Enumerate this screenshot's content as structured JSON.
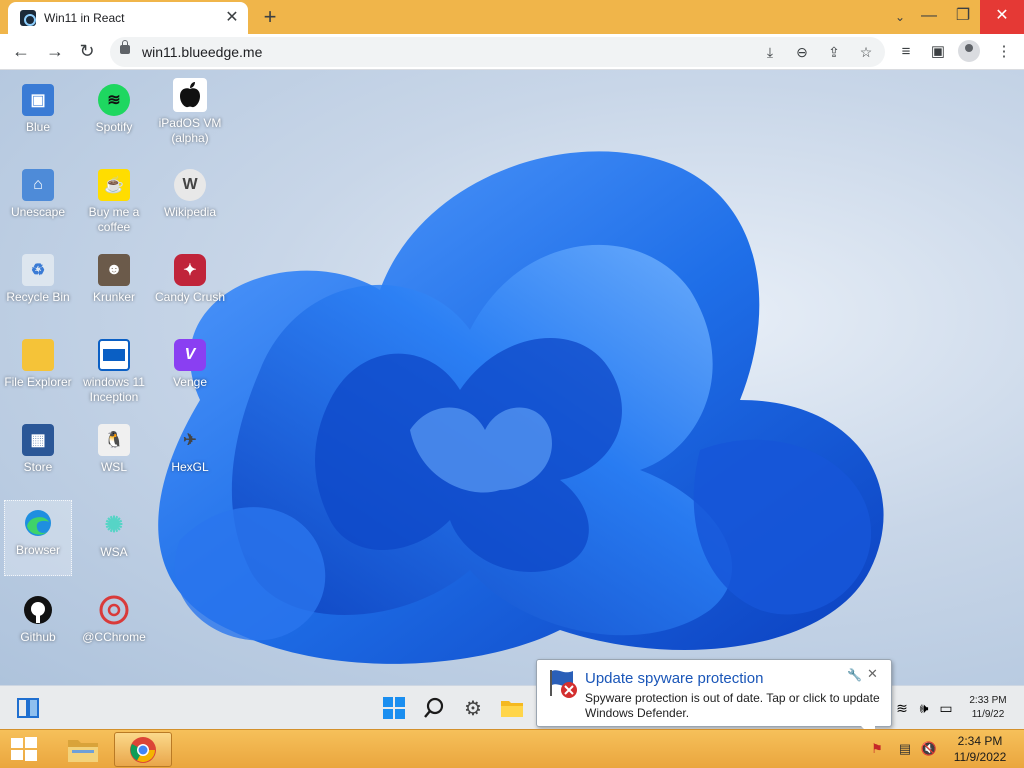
{
  "browser": {
    "tab_title": "Win11 in React",
    "url": "win11.blueedge.me",
    "new_tab_label": "+",
    "tab_close_label": "✕"
  },
  "desktop": {
    "icons": [
      {
        "label": "Blue",
        "icon": "blue-icon"
      },
      {
        "label": "Unescape",
        "icon": "unescape-icon"
      },
      {
        "label": "Recycle Bin",
        "icon": "recycle-bin-icon"
      },
      {
        "label": "File Explorer",
        "icon": "file-explorer-icon"
      },
      {
        "label": "Store",
        "icon": "store-icon"
      },
      {
        "label": "Browser",
        "icon": "edge-icon"
      },
      {
        "label": "Github",
        "icon": "github-icon"
      },
      {
        "label": "Spotify",
        "icon": "spotify-icon"
      },
      {
        "label": "Buy me a coffee",
        "icon": "coffee-icon"
      },
      {
        "label": "Krunker",
        "icon": "krunker-icon"
      },
      {
        "label": "windows 11 Inception",
        "icon": "inception-icon"
      },
      {
        "label": "WSL",
        "icon": "linux-penguin-icon"
      },
      {
        "label": "WSA",
        "icon": "android-icon"
      },
      {
        "label": "@CChrome",
        "icon": "chrome-icon"
      },
      {
        "label": "iPadOS VM (alpha)",
        "icon": "apple-icon"
      },
      {
        "label": "Wikipedia",
        "icon": "wikipedia-icon"
      },
      {
        "label": "Candy Crush",
        "icon": "candy-crush-icon"
      },
      {
        "label": "Venge",
        "icon": "venge-icon"
      },
      {
        "label": "HexGL",
        "icon": "hexgl-icon"
      }
    ],
    "selected_icon": "Browser"
  },
  "win11_taskbar": {
    "time": "2:33 PM",
    "date": "11/9/22"
  },
  "notification": {
    "title": "Update spyware protection",
    "body": "Spyware protection is out of date. Tap or click to update Windows Defender."
  },
  "host_taskbar": {
    "time": "2:34 PM",
    "date": "11/9/2022"
  },
  "colors": {
    "tabstrip": "#f0b54a",
    "host_taskbar": "#eaa63e",
    "wallpaper_bloom": "#1f6fe8",
    "notification_title": "#1a56b8"
  }
}
